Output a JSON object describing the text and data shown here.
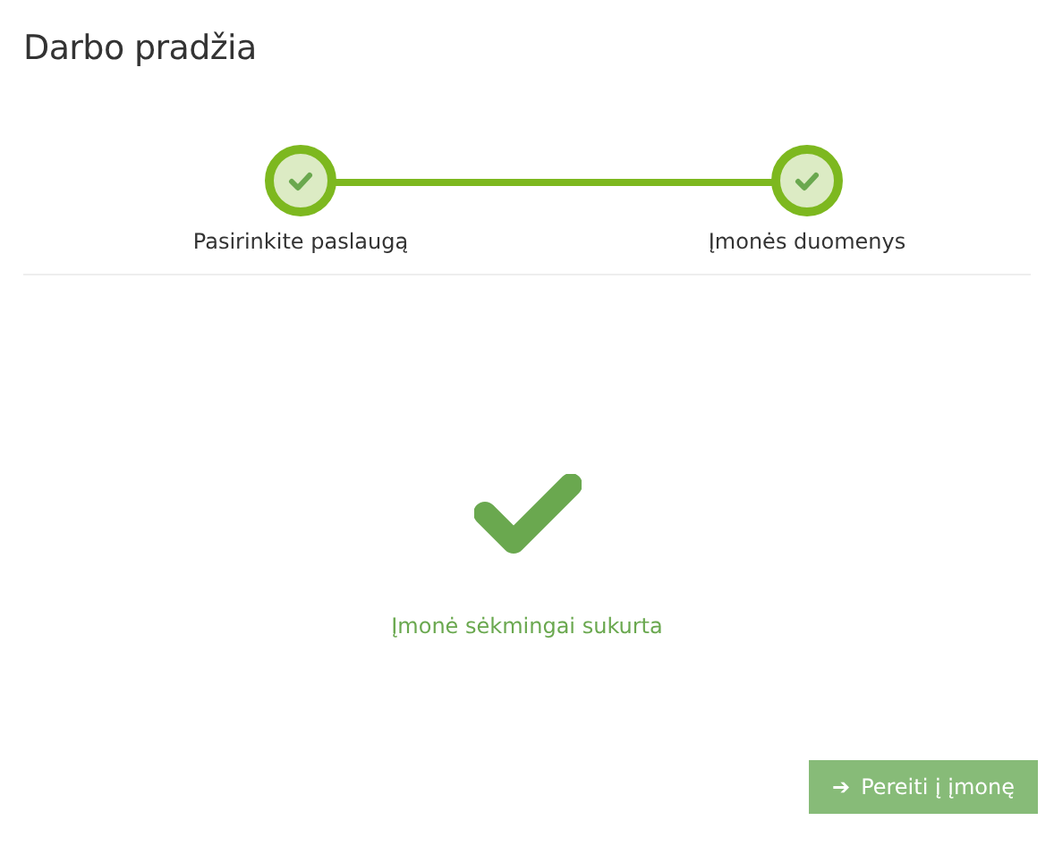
{
  "title": "Darbo pradžia",
  "steps": [
    {
      "label": "Pasirinkite paslaugą",
      "done": true
    },
    {
      "label": "Įmonės duomenys",
      "done": true
    }
  ],
  "message": "Įmonė sėkmingai sukurta",
  "button": {
    "label": "Pereiti į įmonę",
    "icon": "➔"
  }
}
